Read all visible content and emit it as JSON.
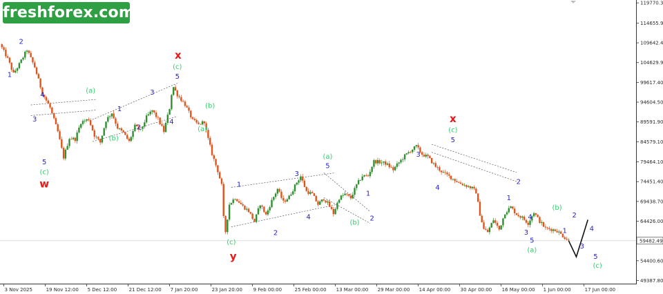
{
  "brand": {
    "logo_text": "freshforex.com"
  },
  "chart_data": {
    "type": "candlestick",
    "instrument_note": "",
    "y_ticks": [
      "119770.30",
      "114655.90",
      "109642.40",
      "104629.90",
      "99617.40",
      "94604.50",
      "89591.90",
      "84579.10",
      "79464.10",
      "74451.40",
      "69438.70",
      "64426.00",
      "59482.49",
      "54400.60",
      "49387.80"
    ],
    "y_values": [
      119770.3,
      114655.9,
      109642.4,
      104629.9,
      99617.4,
      94604.5,
      89591.9,
      84579.1,
      79464.1,
      74451.4,
      69438.7,
      64426.0,
      59482.49,
      54400.6,
      49387.8
    ],
    "ylim": [
      48600,
      120500
    ],
    "current_price": "59482.49",
    "x_ticks": [
      "3 Nov 2025",
      "19 Nov 12:00",
      "5 Dec 12:00",
      "21 Dec 12:00",
      "7 Jan 20:00",
      "23 Jan 20:00",
      "9 Feb 00:00",
      "25 Feb 00:00",
      "13 Mar 00:00",
      "29 Mar 00:00",
      "14 Apr 00:00",
      "30 Apr 00:00",
      "16 May 00:00",
      "1 Jun 00:00",
      "17 Jun 00:00"
    ],
    "price_path": [
      [
        0,
        109300
      ],
      [
        2,
        105600
      ],
      [
        3.5,
        101800
      ],
      [
        5,
        104200
      ],
      [
        7,
        107900
      ],
      [
        9,
        103500
      ],
      [
        11,
        96900
      ],
      [
        13,
        93200
      ],
      [
        15,
        87100
      ],
      [
        16.5,
        80600
      ],
      [
        18,
        85500
      ],
      [
        19.5,
        85200
      ],
      [
        21,
        89500
      ],
      [
        23,
        90300
      ],
      [
        24.5,
        86200
      ],
      [
        26,
        84400
      ],
      [
        27.5,
        90000
      ],
      [
        29,
        91900
      ],
      [
        30.5,
        88100
      ],
      [
        32,
        86800
      ],
      [
        33.5,
        84600
      ],
      [
        35,
        88500
      ],
      [
        36.5,
        87400
      ],
      [
        38,
        90800
      ],
      [
        39.5,
        92500
      ],
      [
        41,
        90300
      ],
      [
        42.5,
        87200
      ],
      [
        44,
        93100
      ],
      [
        44.8,
        98800
      ],
      [
        46,
        96500
      ],
      [
        48,
        94000
      ],
      [
        50,
        90000
      ],
      [
        51.5,
        88900
      ],
      [
        53,
        89700
      ],
      [
        53.6,
        86800
      ],
      [
        55,
        81500
      ],
      [
        56.5,
        77200
      ],
      [
        57.5,
        73500
      ],
      [
        58.3,
        60400
      ],
      [
        59.5,
        68700
      ],
      [
        61,
        70400
      ],
      [
        63,
        68200
      ],
      [
        64.5,
        67000
      ],
      [
        66,
        64300
      ],
      [
        67.5,
        68800
      ],
      [
        69,
        66000
      ],
      [
        70.5,
        69600
      ],
      [
        72,
        72600
      ],
      [
        73.5,
        69300
      ],
      [
        75,
        70600
      ],
      [
        77,
        74300
      ],
      [
        78,
        75800
      ],
      [
        79.5,
        72000
      ],
      [
        81,
        71300
      ],
      [
        82.5,
        68700
      ],
      [
        84,
        70100
      ],
      [
        85,
        69000
      ],
      [
        86.5,
        66400
      ],
      [
        88,
        70300
      ],
      [
        89.5,
        71300
      ],
      [
        91,
        70300
      ],
      [
        92.5,
        73600
      ],
      [
        94,
        75900
      ],
      [
        95.5,
        75900
      ],
      [
        97,
        79600
      ],
      [
        98.5,
        79400
      ],
      [
        100,
        79100
      ],
      [
        102,
        77500
      ],
      [
        103.5,
        79300
      ],
      [
        105,
        81000
      ],
      [
        106.5,
        82300
      ],
      [
        108,
        83400
      ],
      [
        109.5,
        81400
      ],
      [
        111,
        80700
      ],
      [
        113,
        78300
      ],
      [
        115,
        76700
      ],
      [
        117,
        75500
      ],
      [
        119,
        74200
      ],
      [
        121,
        73400
      ],
      [
        122.5,
        72800
      ],
      [
        123.5,
        71800
      ],
      [
        124.5,
        66200
      ],
      [
        125.5,
        62400
      ],
      [
        126.5,
        61700
      ],
      [
        128,
        64800
      ],
      [
        129.5,
        62300
      ],
      [
        131,
        66600
      ],
      [
        132.5,
        68000
      ],
      [
        134,
        66200
      ],
      [
        135.5,
        65300
      ],
      [
        137,
        63900
      ],
      [
        138.5,
        66700
      ],
      [
        140,
        64400
      ],
      [
        141.5,
        62600
      ],
      [
        143,
        62400
      ],
      [
        144.5,
        62000
      ],
      [
        146,
        60700
      ],
      [
        147.5,
        59500
      ]
    ],
    "projection": [
      [
        147.5,
        59500
      ],
      [
        149.5,
        55400
      ],
      [
        152.5,
        64800
      ]
    ],
    "wave_labels": [
      {
        "t": "1",
        "type": "impulse",
        "i": 2.5,
        "v": 101000
      },
      {
        "t": "2",
        "type": "impulse",
        "i": 5.5,
        "v": 109400
      },
      {
        "t": "3",
        "type": "impulse",
        "i": 9,
        "v": 89700
      },
      {
        "t": "4",
        "type": "impulse",
        "i": 11,
        "v": 95900
      },
      {
        "t": "5",
        "type": "impulse",
        "i": 11.5,
        "v": 78900
      },
      {
        "t": "(c)",
        "type": "corrective",
        "i": 11.5,
        "v": 76300
      },
      {
        "t": "w",
        "type": "major",
        "i": 11.5,
        "v": 73000
      },
      {
        "t": "(a)",
        "type": "corrective",
        "i": 23.5,
        "v": 97000
      },
      {
        "t": "(b)",
        "type": "corrective",
        "i": 29.5,
        "v": 84900
      },
      {
        "t": "1",
        "type": "impulse",
        "i": 31,
        "v": 92300
      },
      {
        "t": "2",
        "type": "impulse",
        "i": 36,
        "v": 87700
      },
      {
        "t": "3",
        "type": "impulse",
        "i": 39.5,
        "v": 96500
      },
      {
        "t": "4",
        "type": "impulse",
        "i": 44.5,
        "v": 89100
      },
      {
        "t": "5",
        "type": "impulse",
        "i": 46,
        "v": 100600
      },
      {
        "t": "(c)",
        "type": "corrective",
        "i": 46,
        "v": 103000
      },
      {
        "t": "x",
        "type": "major",
        "i": 46.2,
        "v": 105600
      },
      {
        "t": "(b)",
        "type": "corrective",
        "i": 54.5,
        "v": 93100
      },
      {
        "t": "(a)",
        "type": "corrective",
        "i": 52.5,
        "v": 87300
      },
      {
        "t": "(c)",
        "type": "corrective",
        "i": 60,
        "v": 58600
      },
      {
        "t": "y",
        "type": "major",
        "i": 60.5,
        "v": 54600
      },
      {
        "t": "1",
        "type": "impulse",
        "i": 62,
        "v": 73200
      },
      {
        "t": "2",
        "type": "impulse",
        "i": 71.5,
        "v": 60900
      },
      {
        "t": "3",
        "type": "impulse",
        "i": 77,
        "v": 75900
      },
      {
        "t": "4",
        "type": "impulse",
        "i": 80,
        "v": 65000
      },
      {
        "t": "5",
        "type": "impulse",
        "i": 85,
        "v": 77900
      },
      {
        "t": "(a)",
        "type": "corrective",
        "i": 85,
        "v": 80300
      },
      {
        "t": "(b)",
        "type": "corrective",
        "i": 92,
        "v": 63600
      },
      {
        "t": "1",
        "type": "impulse",
        "i": 95.5,
        "v": 70900
      },
      {
        "t": "2",
        "type": "impulse",
        "i": 96.5,
        "v": 64600
      },
      {
        "t": "3",
        "type": "impulse",
        "i": 108.5,
        "v": 80800
      },
      {
        "t": "4",
        "type": "impulse",
        "i": 113.5,
        "v": 72400
      },
      {
        "t": "5",
        "type": "impulse",
        "i": 117.5,
        "v": 84500
      },
      {
        "t": "(c)",
        "type": "corrective",
        "i": 117.5,
        "v": 87000
      },
      {
        "t": "x",
        "type": "major",
        "i": 117.5,
        "v": 89500
      },
      {
        "t": "1",
        "type": "impulse",
        "i": 132,
        "v": 69800
      },
      {
        "t": "2",
        "type": "impulse",
        "i": 134.5,
        "v": 73900
      },
      {
        "t": "3",
        "type": "impulse",
        "i": 136.5,
        "v": 61000
      },
      {
        "t": "4",
        "type": "impulse",
        "i": 137.5,
        "v": 65000
      },
      {
        "t": "5",
        "type": "impulse",
        "i": 138,
        "v": 59000
      },
      {
        "t": "(a)",
        "type": "corrective",
        "i": 138,
        "v": 56600
      },
      {
        "t": "(b)",
        "type": "corrective",
        "i": 144.5,
        "v": 67300
      },
      {
        "t": "1",
        "type": "impulse",
        "i": 146.5,
        "v": 61500
      },
      {
        "t": "2",
        "type": "impulse",
        "i": 149,
        "v": 65400
      },
      {
        "t": "3",
        "type": "impulse",
        "i": 151,
        "v": 57500
      },
      {
        "t": "4",
        "type": "impulse",
        "i": 153.5,
        "v": 62000
      },
      {
        "t": "5",
        "type": "impulse",
        "i": 154.5,
        "v": 54900
      },
      {
        "t": "(c)",
        "type": "corrective",
        "i": 155,
        "v": 52600
      }
    ],
    "channels": [
      [
        [
          8,
          93900
        ],
        [
          25,
          95300
        ],
        [
          8,
          91200
        ],
        [
          25,
          92600
        ]
      ],
      [
        [
          24,
          90200
        ],
        [
          46,
          99400
        ],
        [
          24,
          84600
        ],
        [
          46,
          91000
        ]
      ],
      [
        [
          60,
          73000
        ],
        [
          87,
          76700
        ],
        [
          60,
          63000
        ],
        [
          87,
          68600
        ]
      ],
      [
        [
          84,
          76700
        ],
        [
          96,
          66900
        ],
        [
          84,
          70400
        ],
        [
          96,
          63900
        ]
      ],
      [
        [
          112,
          83900
        ],
        [
          134,
          76800
        ],
        [
          112,
          81900
        ],
        [
          134,
          74500
        ]
      ]
    ],
    "colors": {
      "up_candle": "#2f8f2f",
      "down_candle": "#e0541c",
      "impulse_label": "#2323c8",
      "corrective_label": "#2fcf6c",
      "major_label": "#e81818",
      "projection": "#111111",
      "channel": "#555555",
      "logo_bg": "#2ea043"
    }
  }
}
